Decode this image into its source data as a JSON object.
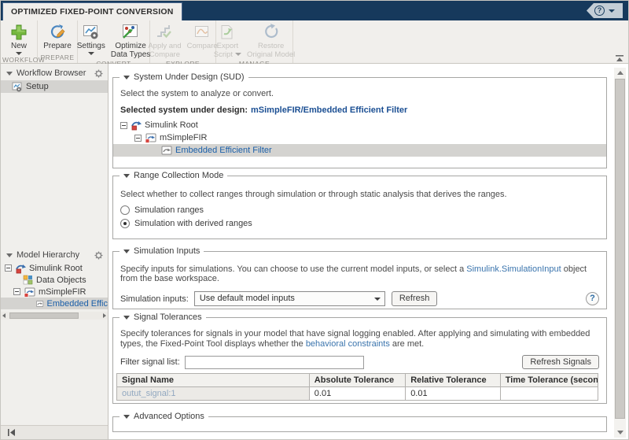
{
  "colors": {
    "titlebar_navy": "#16395c",
    "selection_gray": "#d4d3d0",
    "link_blue": "#3a74ad",
    "selected_value_blue": "#1b4f93",
    "signal_link_blue": "#92a8c0",
    "new_button_green": "#76b83f"
  },
  "tab": {
    "title": "OPTIMIZED FIXED-POINT CONVERSION"
  },
  "help_button": {
    "label": "?"
  },
  "ribbon": {
    "groups": {
      "workflow": "WORKFLOW",
      "prepare": "PREPARE",
      "convert": "CONVERT",
      "explore": "EXPLORE",
      "manage": "MANAGE"
    },
    "buttons": {
      "new": "New",
      "prepare": "Prepare",
      "settings": "Settings",
      "optimize1": "Optimize",
      "optimize2": "Data Types",
      "apply1": "Apply and",
      "apply2": "Compare",
      "compare": "Compare",
      "export1": "Export",
      "export2": "Script",
      "restore1": "Restore",
      "restore2": "Original Model"
    }
  },
  "sidebar": {
    "workflow_browser": {
      "title": "Workflow Browser",
      "setup": "Setup"
    },
    "model_hierarchy": {
      "title": "Model Hierarchy",
      "root": "Simulink Root",
      "data_objects": "Data Objects",
      "subsystem": "mSimpleFIR",
      "child": "Embedded Effic"
    }
  },
  "sud": {
    "title": "System Under Design (SUD)",
    "description": "Select the system to analyze or convert.",
    "selected_label": "Selected system under design:",
    "selected_value": "mSimpleFIR/Embedded Efficient Filter",
    "tree": {
      "root": "Simulink Root",
      "child": "mSimpleFIR",
      "leaf": "Embedded Efficient Filter"
    }
  },
  "range_mode": {
    "title": "Range Collection Mode",
    "description": "Select whether to collect ranges through simulation or through static analysis that derives the ranges.",
    "options": [
      {
        "label": "Simulation ranges",
        "selected": false
      },
      {
        "label": "Simulation with derived ranges",
        "selected": true
      }
    ]
  },
  "sim_inputs": {
    "title": "Simulation Inputs",
    "description_pre": "Specify inputs for simulations. You can choose to use the current model inputs, or select a ",
    "description_link": "Simulink.SimulationInput",
    "description_post": " object from the base workspace.",
    "field_label": "Simulation inputs:",
    "dropdown_value": "Use default model inputs",
    "refresh_label": "Refresh",
    "help_label": "?"
  },
  "signal_tolerances": {
    "title": "Signal Tolerances",
    "description_pre": "Specify tolerances for signals in your model that have signal logging enabled. After applying and simulating with embedded types, the Fixed-Point Tool displays whether the ",
    "description_link": "behavioral constraints",
    "description_post": " are met.",
    "filter_label": "Filter signal list:",
    "filter_value": "",
    "refresh_signals_label": "Refresh Signals",
    "table": {
      "headers": [
        "Signal Name",
        "Absolute Tolerance",
        "Relative Tolerance",
        "Time Tolerance (seconds)"
      ],
      "rows": [
        {
          "signal": "outut_signal:1",
          "absolute": "0.01",
          "relative": "0.01",
          "time": ""
        }
      ]
    }
  },
  "advanced": {
    "title": "Advanced Options"
  }
}
